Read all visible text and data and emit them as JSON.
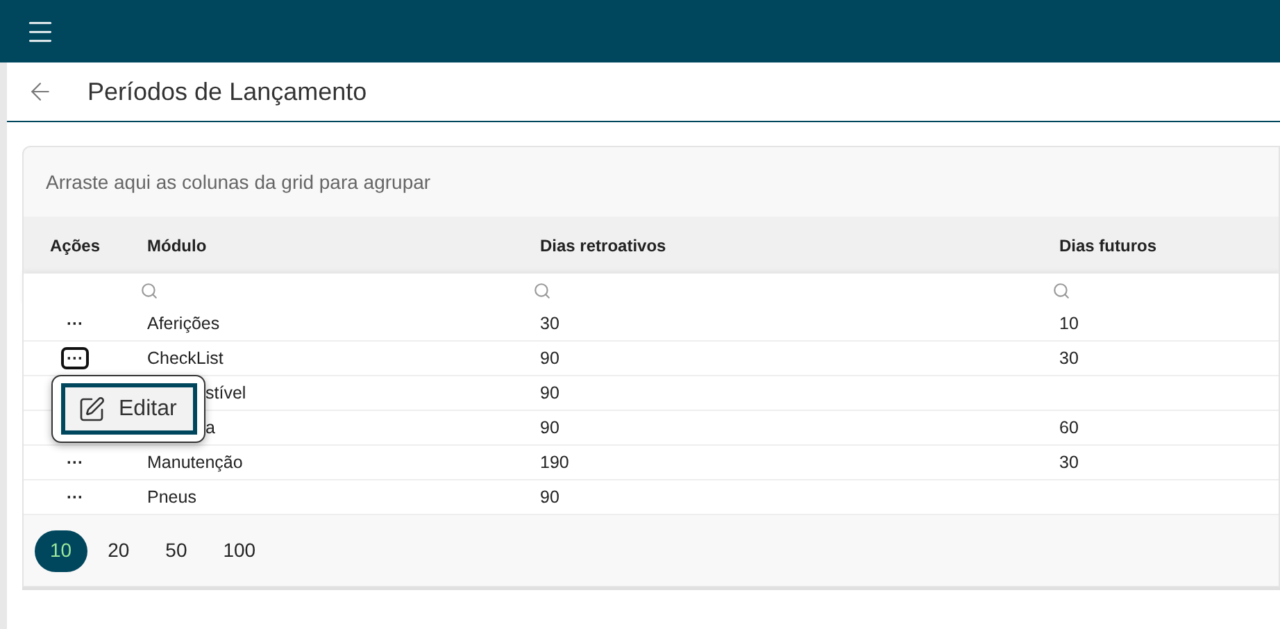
{
  "header": {
    "title": "Períodos de Lançamento"
  },
  "group_panel": {
    "text": "Arraste aqui as colunas da grid para agrupar"
  },
  "table": {
    "columns": [
      "Ações",
      "Módulo",
      "Dias retroativos",
      "Dias futuros"
    ],
    "rows": [
      {
        "actions": "···",
        "module": "Aferições",
        "back": "30",
        "future": "10",
        "menu_open": false,
        "covered": false
      },
      {
        "actions": "···",
        "module": "CheckList",
        "back": "90",
        "future": "30",
        "menu_open": true,
        "covered": false
      },
      {
        "module": "stível",
        "back": "90",
        "covered": true
      },
      {
        "module": "a",
        "back": "90",
        "future": "60",
        "covered": true
      },
      {
        "actions": "···",
        "module": "Manutenção",
        "back": "190",
        "future": "30",
        "menu_open": false,
        "covered": false
      },
      {
        "actions": "···",
        "module": "Pneus",
        "back": "90",
        "menu_open": false,
        "covered": false
      }
    ]
  },
  "popup_menu": {
    "items": [
      {
        "label": "Editar",
        "selected": true
      }
    ]
  },
  "pager": {
    "sizes": [
      {
        "label": "10",
        "selected": true
      },
      {
        "label": "20",
        "selected": false
      },
      {
        "label": "50",
        "selected": false
      },
      {
        "label": "100",
        "selected": false
      }
    ]
  }
}
